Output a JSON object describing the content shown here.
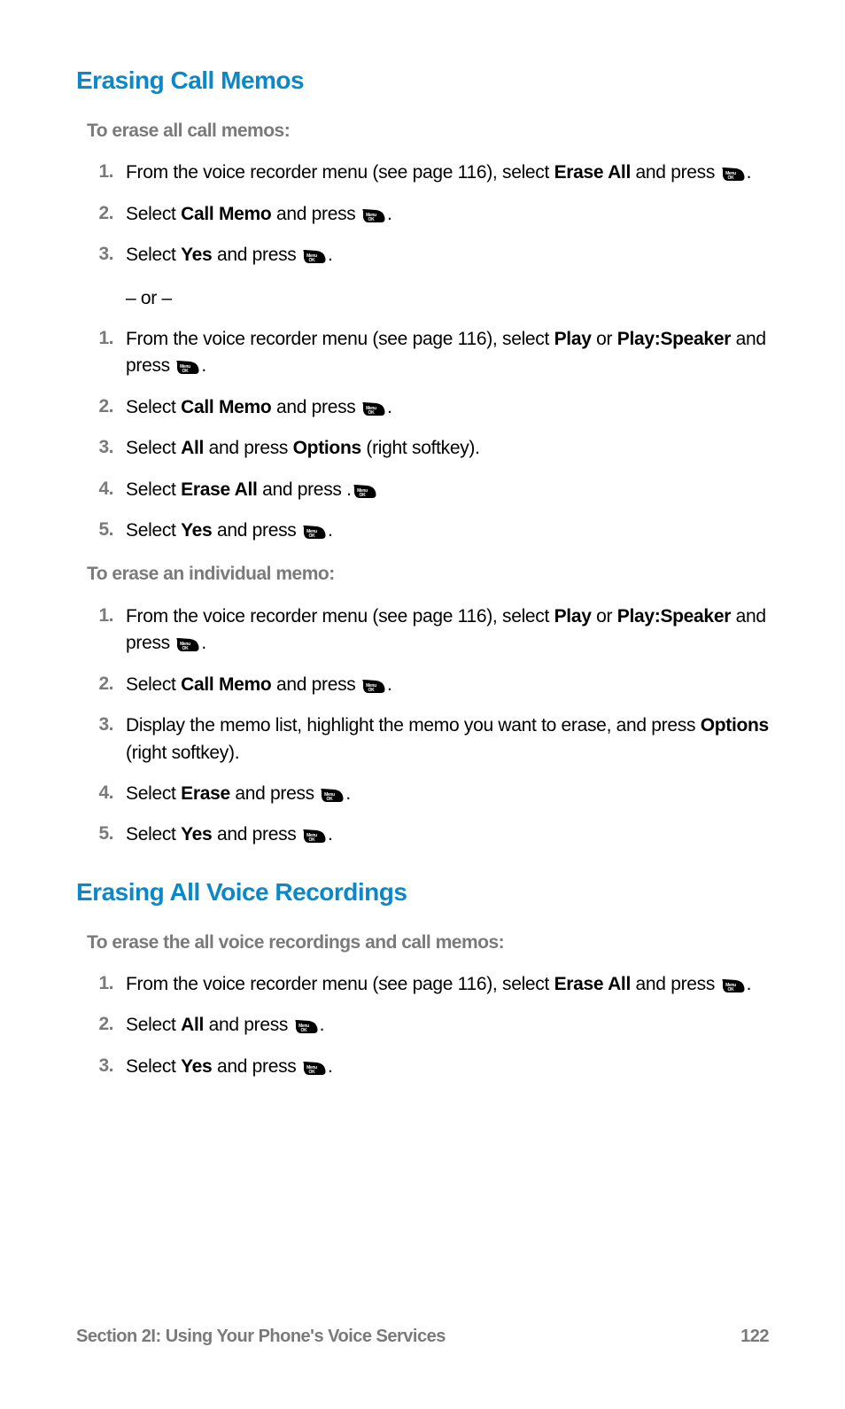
{
  "heading1": "Erasing Call Memos",
  "sub1": "To erase all call memos:",
  "listA": [
    {
      "n": "1.",
      "parts": [
        "From the voice recorder menu (see page 116), select ",
        {
          "b": "Erase All"
        },
        " and press ",
        {
          "icon": true
        },
        "."
      ]
    },
    {
      "n": "2.",
      "parts": [
        "Select ",
        {
          "b": "Call Memo"
        },
        " and press ",
        {
          "icon": true
        },
        "."
      ]
    },
    {
      "n": "3.",
      "parts": [
        "Select ",
        {
          "b": "Yes"
        },
        " and press ",
        {
          "icon": true
        },
        "."
      ]
    }
  ],
  "or": "– or –",
  "listB": [
    {
      "n": "1.",
      "parts": [
        "From the voice recorder menu (see page 116), select ",
        {
          "b": "Play"
        },
        " or ",
        {
          "b": "Play:Speaker"
        },
        " and press ",
        {
          "icon": true
        },
        "."
      ]
    },
    {
      "n": "2.",
      "parts": [
        "Select ",
        {
          "b": "Call Memo"
        },
        " and press ",
        {
          "icon": true
        },
        "."
      ]
    },
    {
      "n": "3.",
      "parts": [
        "Select ",
        {
          "b": "All"
        },
        " and press ",
        {
          "b": "Options"
        },
        " (right softkey)."
      ]
    },
    {
      "n": "4.",
      "parts": [
        "Select ",
        {
          "b": "Erase All"
        },
        " and press .",
        {
          "icon": true
        }
      ]
    },
    {
      "n": "5.",
      "parts": [
        "Select ",
        {
          "b": "Yes"
        },
        " and press ",
        {
          "icon": true
        },
        "."
      ]
    }
  ],
  "sub2": "To erase an individual memo:",
  "listC": [
    {
      "n": "1.",
      "parts": [
        "From the voice recorder menu (see page 116), select ",
        {
          "b": "Play"
        },
        " or ",
        {
          "b": "Play:Speaker"
        },
        " and press ",
        {
          "icon": true
        },
        "."
      ]
    },
    {
      "n": "2.",
      "parts": [
        "Select ",
        {
          "b": "Call Memo"
        },
        " and press ",
        {
          "icon": true
        },
        "."
      ]
    },
    {
      "n": "3.",
      "parts": [
        "Display the memo list, highlight the memo you want to erase, and press ",
        {
          "b": "Options"
        },
        " (right softkey)."
      ]
    },
    {
      "n": "4.",
      "parts": [
        "Select ",
        {
          "b": "Erase"
        },
        " and press ",
        {
          "icon": true
        },
        "."
      ]
    },
    {
      "n": "5.",
      "parts": [
        "Select ",
        {
          "b": "Yes"
        },
        " and press ",
        {
          "icon": true
        },
        "."
      ]
    }
  ],
  "heading2": "Erasing All Voice Recordings",
  "sub3": "To erase the all voice recordings and call memos:",
  "listD": [
    {
      "n": "1.",
      "parts": [
        "From the voice recorder menu (see page 116), select ",
        {
          "b": "Erase All"
        },
        " and press ",
        {
          "icon": true
        },
        "."
      ]
    },
    {
      "n": "2.",
      "parts": [
        "Select ",
        {
          "b": "All"
        },
        " and press ",
        {
          "icon": true
        },
        "."
      ]
    },
    {
      "n": "3.",
      "parts": [
        "Select ",
        {
          "b": "Yes"
        },
        " and press ",
        {
          "icon": true
        },
        "."
      ]
    }
  ],
  "footer_left": "Section 2I: Using Your Phone's Voice Services",
  "footer_right": "122",
  "icon_label": "Menu OK"
}
